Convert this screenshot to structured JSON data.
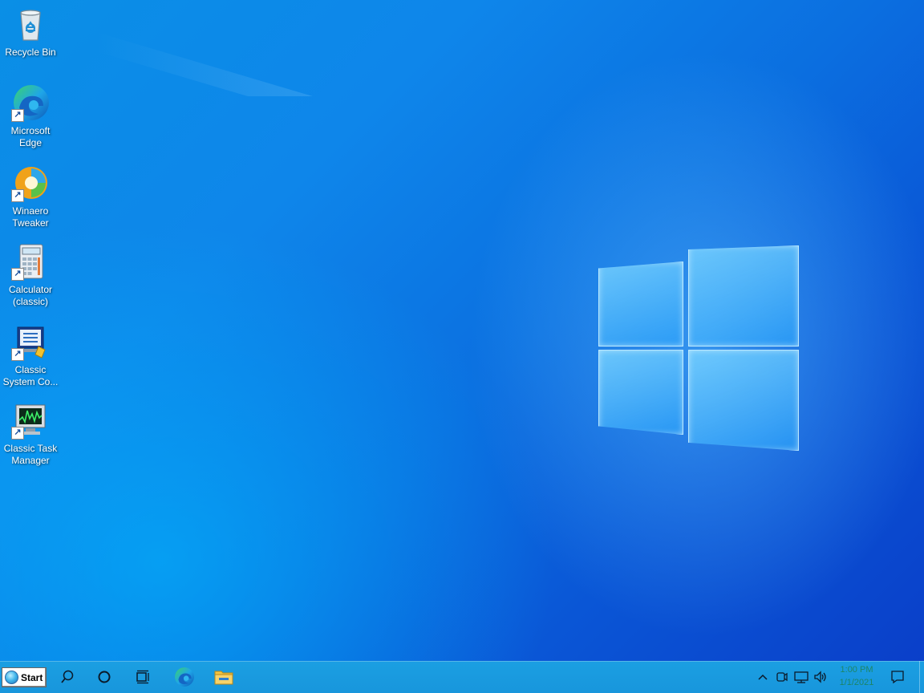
{
  "desktop": {
    "icons": [
      {
        "label": "Recycle Bin",
        "icon": "recycle-bin-icon",
        "shortcut": false
      },
      {
        "label": "Microsoft Edge",
        "icon": "edge-icon",
        "shortcut": true
      },
      {
        "label": "Winaero Tweaker",
        "icon": "winaero-tweaker-icon",
        "shortcut": true
      },
      {
        "label": "Calculator (classic)",
        "icon": "calculator-icon",
        "shortcut": true
      },
      {
        "label": "Classic System Co...",
        "icon": "system-configuration-icon",
        "shortcut": true
      },
      {
        "label": "Classic Task Manager",
        "icon": "task-manager-icon",
        "shortcut": true
      }
    ],
    "shortcut_glyph": "↗"
  },
  "taskbar": {
    "start_label": "Start",
    "buttons": [
      {
        "name": "search",
        "icon": "search-icon"
      },
      {
        "name": "cortana",
        "icon": "cortana-icon"
      },
      {
        "name": "task-view",
        "icon": "task-view-icon"
      },
      {
        "name": "edge",
        "icon": "edge-icon"
      },
      {
        "name": "file-explorer",
        "icon": "folder-icon"
      }
    ],
    "tray": {
      "icons": [
        "chevron-up-icon",
        "meet-now-icon",
        "network-icon",
        "volume-icon",
        "notification-icon"
      ]
    },
    "clock": {
      "time": "1:00 PM",
      "date": "1/1/2021"
    },
    "colors": {
      "taskbar": "#1896dc",
      "clock_text": "#1e7f3e"
    }
  }
}
